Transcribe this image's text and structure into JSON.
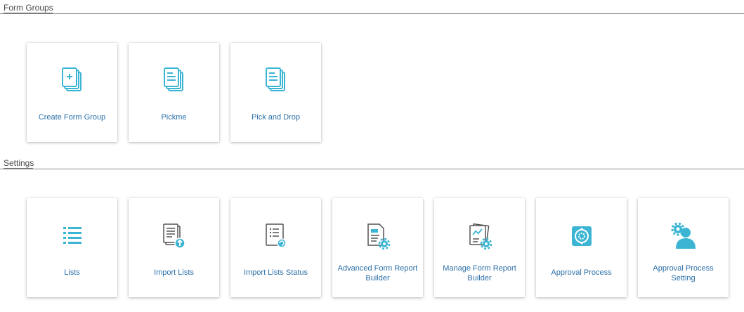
{
  "form_groups": {
    "title": "Form Groups",
    "cards": [
      {
        "label": "Create Form Group",
        "icon": "document-plus-icon"
      },
      {
        "label": "Pickme",
        "icon": "document-stack-icon"
      },
      {
        "label": "Pick and Drop",
        "icon": "document-stack-icon"
      }
    ]
  },
  "settings": {
    "title": "Settings",
    "cards": [
      {
        "label": "Lists",
        "icon": "list-icon"
      },
      {
        "label": "Import Lists",
        "icon": "import-list-icon"
      },
      {
        "label": "Import Lists Status",
        "icon": "import-status-icon"
      },
      {
        "label": "Advanced Form Report Builder",
        "icon": "report-builder-gear-icon"
      },
      {
        "label": "Manage Form Report Builder",
        "icon": "chart-report-gear-icon"
      },
      {
        "label": "Approval Process",
        "icon": "approval-cycle-icon"
      },
      {
        "label": "Approval Process Setting",
        "icon": "user-gear-icon"
      }
    ]
  },
  "colors": {
    "accent": "#3cb5d4",
    "label": "#2b6fa8",
    "title": "#4a4a4a"
  }
}
